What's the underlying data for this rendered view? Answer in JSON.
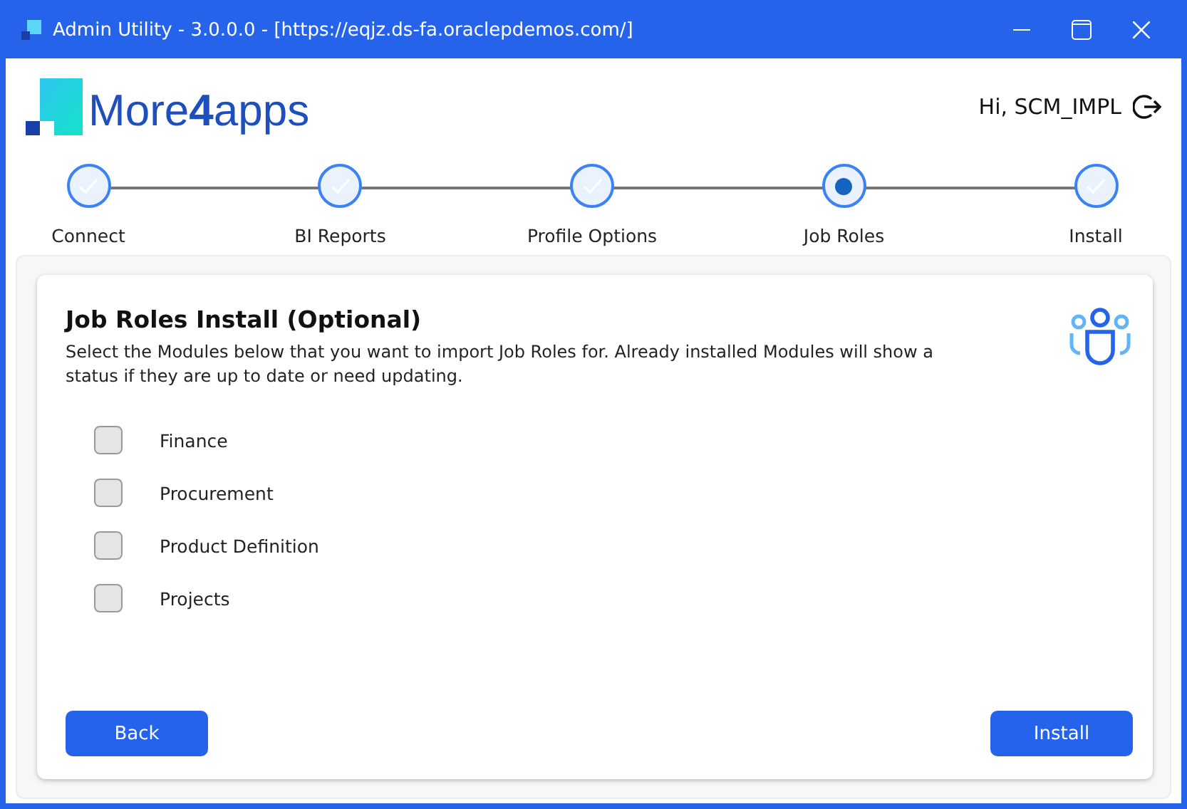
{
  "window": {
    "title": "Admin Utility - 3.0.0.0 - [https://eqjz.ds-fa.oraclepdemos.com/]"
  },
  "header": {
    "logo": "More**4**apps",
    "greeting": "Hi, SCM_IMPL"
  },
  "steps": [
    {
      "label": "Connect",
      "completed": true,
      "selected": false
    },
    {
      "label": "BI Reports",
      "completed": true,
      "selected": false
    },
    {
      "label": "Profile Options",
      "completed": true,
      "selected": false
    },
    {
      "label": "Job Roles",
      "completed": false,
      "selected": true
    },
    {
      "label": "Install",
      "completed": true,
      "selected": false
    }
  ],
  "section": {
    "title": "Job Roles Install (Optional)",
    "description": "Select the Modules below that you want to import Job Roles for. Already installed Modules will show a status if they are up to date or need updating."
  },
  "modules": [
    {
      "label": "Finance",
      "checked": false
    },
    {
      "label": "Procurement",
      "checked": false
    },
    {
      "label": "Product Definition",
      "checked": false
    },
    {
      "label": "Projects",
      "checked": false
    }
  ],
  "buttons": [
    {
      "label": "Back"
    },
    {
      "label": "Install"
    }
  ]
}
